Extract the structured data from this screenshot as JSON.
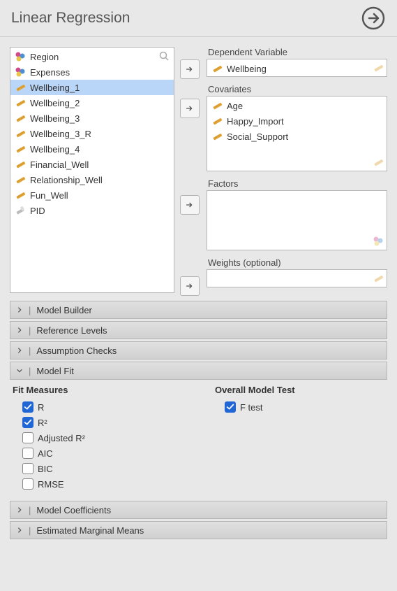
{
  "header": {
    "title": "Linear Regression"
  },
  "variables": [
    {
      "name": "Region",
      "type": "nominal"
    },
    {
      "name": "Expenses",
      "type": "nominal"
    },
    {
      "name": "Wellbeing_1",
      "type": "scale",
      "selected": true
    },
    {
      "name": "Wellbeing_2",
      "type": "scale"
    },
    {
      "name": "Wellbeing_3",
      "type": "scale"
    },
    {
      "name": "Wellbeing_3_R",
      "type": "scale"
    },
    {
      "name": "Wellbeing_4",
      "type": "scale"
    },
    {
      "name": "Financial_Well",
      "type": "scale"
    },
    {
      "name": "Relationship_Well",
      "type": "scale"
    },
    {
      "name": "Fun_Well",
      "type": "scale"
    },
    {
      "name": "PID",
      "type": "id"
    }
  ],
  "right": {
    "dependent": {
      "label": "Dependent Variable",
      "items": [
        {
          "name": "Wellbeing",
          "type": "scale"
        }
      ],
      "hint": "scale"
    },
    "covariates": {
      "label": "Covariates",
      "items": [
        {
          "name": "Age",
          "type": "scale"
        },
        {
          "name": "Happy_Import",
          "type": "scale"
        },
        {
          "name": "Social_Support",
          "type": "scale"
        }
      ],
      "hint": "scale"
    },
    "factors": {
      "label": "Factors",
      "items": [],
      "hint": "nominal"
    },
    "weights": {
      "label": "Weights (optional)",
      "items": [],
      "hint": "scale"
    }
  },
  "sections": {
    "model_builder": {
      "label": "Model Builder",
      "expanded": false
    },
    "reference_levels": {
      "label": "Reference Levels",
      "expanded": false
    },
    "assumption": {
      "label": "Assumption Checks",
      "expanded": false
    },
    "model_fit": {
      "label": "Model Fit",
      "expanded": true
    },
    "coefficients": {
      "label": "Model Coefficients",
      "expanded": false
    },
    "margins": {
      "label": "Estimated Marginal Means",
      "expanded": false
    }
  },
  "model_fit": {
    "fit_heading": "Fit Measures",
    "overall_heading": "Overall Model Test",
    "fit_measures": [
      {
        "label": "R",
        "checked": true
      },
      {
        "label": "R²",
        "checked": true
      },
      {
        "label": "Adjusted R²",
        "checked": false
      },
      {
        "label": "AIC",
        "checked": false
      },
      {
        "label": "BIC",
        "checked": false
      },
      {
        "label": "RMSE",
        "checked": false
      }
    ],
    "overall_tests": [
      {
        "label": "F test",
        "checked": true
      }
    ]
  }
}
